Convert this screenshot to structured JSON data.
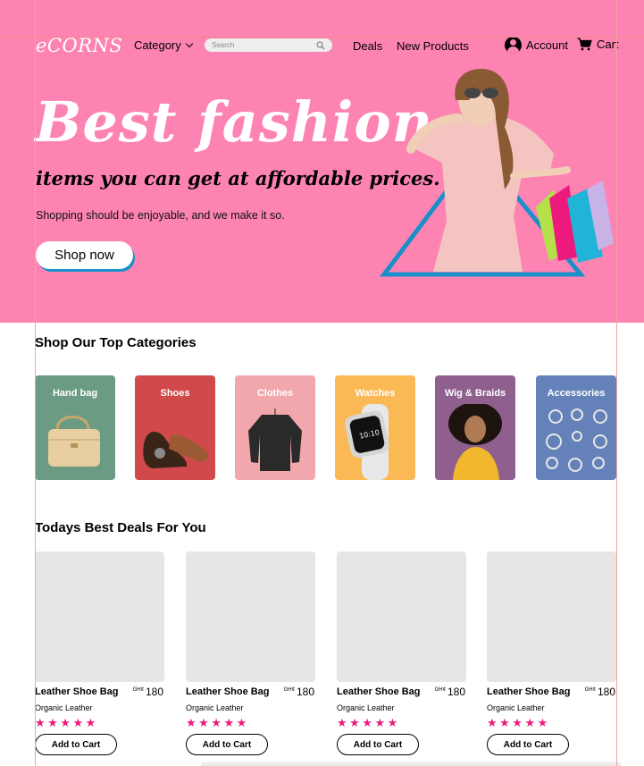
{
  "header": {
    "logo": "eCORNS",
    "category_label": "Category",
    "search_placeholder": "Search",
    "deals_label": "Deals",
    "new_products_label": "New Products",
    "account_label": "Account",
    "cart_label": "Cart"
  },
  "hero": {
    "title": "Best fashion",
    "subtitle": "items you can get at affordable prices.",
    "tagline": "Shopping should be enjoyable, and we make it so.",
    "cta_label": "Shop now"
  },
  "categories_section": {
    "title": "Shop Our Top Categories",
    "items": [
      {
        "label": "Hand bag",
        "color": "#6b9b82",
        "icon": "handbag-icon"
      },
      {
        "label": "Shoes",
        "color": "#d04a4b",
        "icon": "shoes-icon"
      },
      {
        "label": "Clothes",
        "color": "#f1a7ab",
        "icon": "sweater-icon"
      },
      {
        "label": "Watches",
        "color": "#fbb955",
        "icon": "smartwatch-icon"
      },
      {
        "label": "Wig & Braids",
        "color": "#8f5f8e",
        "icon": "wig-model-icon"
      },
      {
        "label": "Accessories",
        "color": "#6482b9",
        "icon": "jewelry-icon"
      }
    ]
  },
  "deals_section": {
    "title": "Todays Best Deals For You",
    "products": [
      {
        "name": "Leather Shoe Bag",
        "currency": "GH¢",
        "price": "180",
        "subtitle": "Organic Leather",
        "rating": "★★★★★",
        "button": "Add to Cart"
      },
      {
        "name": "Leather Shoe Bag",
        "currency": "GH¢",
        "price": "180",
        "subtitle": "Organic Leather",
        "rating": "★★★★★",
        "button": "Add to Cart"
      },
      {
        "name": "Leather Shoe Bag",
        "currency": "GH¢",
        "price": "180",
        "subtitle": "Organic Leather",
        "rating": "★★★★★",
        "button": "Add to Cart"
      },
      {
        "name": "Leather Shoe Bag",
        "currency": "GH¢",
        "price": "180",
        "subtitle": "Organic Leather",
        "rating": "★★★★★",
        "button": "Add to Cart"
      }
    ]
  },
  "colors": {
    "hero_background": "#fd83b2",
    "accent_blue": "#1a8fc9",
    "star_pink": "#ec1a7d",
    "placeholder_gray": "#e6e6e6"
  }
}
